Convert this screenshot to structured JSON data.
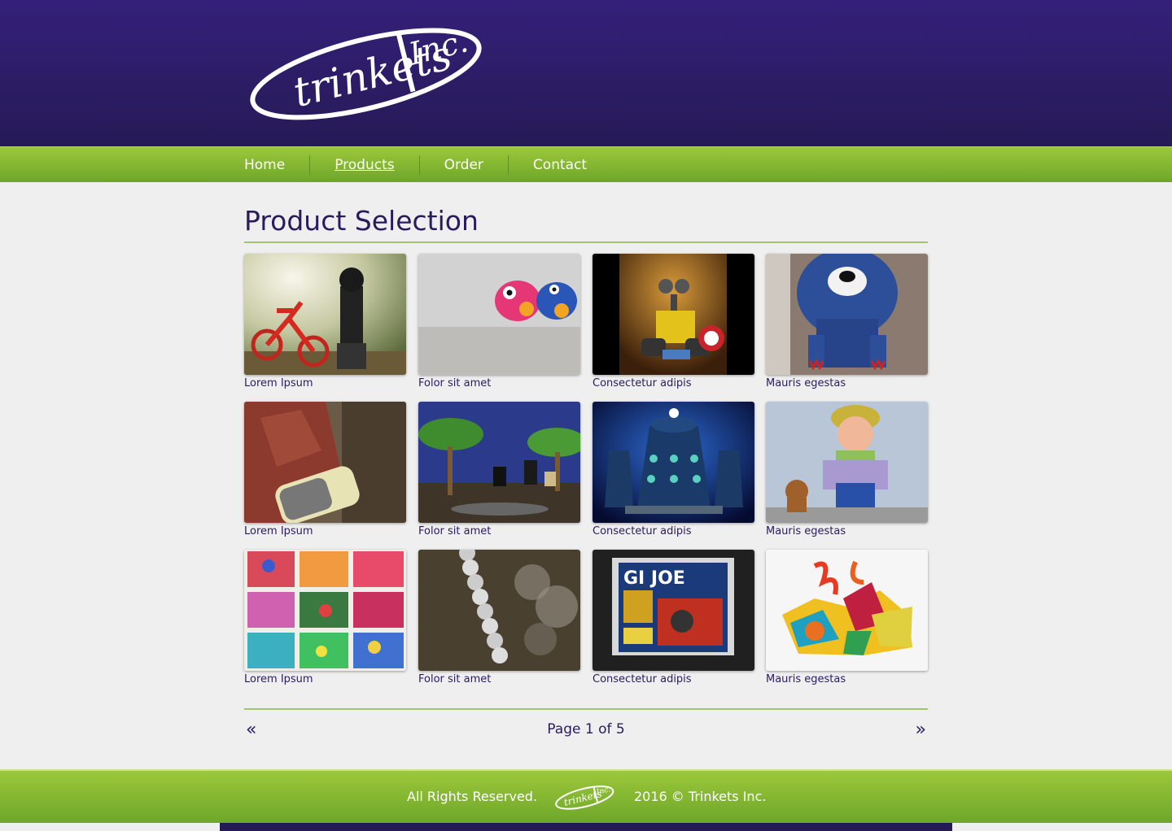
{
  "brand": {
    "name": "trinkets Inc.",
    "logo_text": "trinkets",
    "logo_suffix": "Inc."
  },
  "nav": [
    {
      "label": "Home",
      "active": false
    },
    {
      "label": "Products",
      "active": true
    },
    {
      "label": "Order",
      "active": false
    },
    {
      "label": "Contact",
      "active": false
    }
  ],
  "page_title": "Product Selection",
  "products": [
    {
      "caption": "Lorem Ipsum",
      "image": "lego-bicycle-photo"
    },
    {
      "caption": "Folor sit amet",
      "image": "clay-fish-photo"
    },
    {
      "caption": "Consectetur adipis",
      "image": "robot-toy-photo"
    },
    {
      "caption": "Mauris egestas",
      "image": "blue-bear-photo"
    },
    {
      "caption": "Lorem Ipsum",
      "image": "figure-with-money-photo"
    },
    {
      "caption": "Folor sit amet",
      "image": "lego-diorama-photo"
    },
    {
      "caption": "Consectetur adipis",
      "image": "daleks-photo"
    },
    {
      "caption": "Mauris egestas",
      "image": "doll-with-dog-photo"
    },
    {
      "caption": "Lorem Ipsum",
      "image": "toy-box-photo"
    },
    {
      "caption": "Folor sit amet",
      "image": "metal-beads-photo"
    },
    {
      "caption": "Consectetur adipis",
      "image": "gijoe-package-photo"
    },
    {
      "caption": "Mauris egestas",
      "image": "colorful-paper-craft-photo"
    }
  ],
  "pagination": {
    "prev": "«",
    "next": "»",
    "info": "Page 1 of 5",
    "current": 1,
    "total": 5
  },
  "footer": {
    "rights": "All Rights Reserved.",
    "copyright": "2016 © Trinkets Inc."
  },
  "colors": {
    "header": "#2c1d68",
    "nav": "#8cbb33",
    "accent_text": "#2a1c5c",
    "background": "#efefef"
  }
}
